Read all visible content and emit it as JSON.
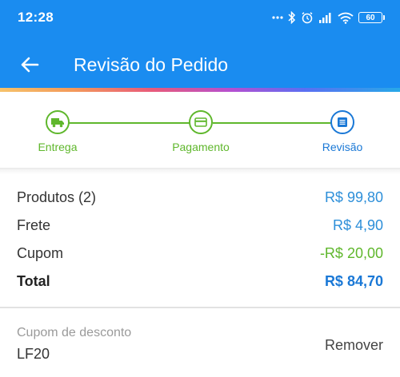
{
  "status_bar": {
    "time": "12:28",
    "battery": "60",
    "icons": [
      "more-dots-icon",
      "bluetooth-icon",
      "alarm-icon",
      "signal-icon",
      "wifi-icon",
      "battery-icon"
    ]
  },
  "app_bar": {
    "title": "Revisão do Pedido",
    "back_icon": "arrow-left-icon",
    "color": "#1a8cf0"
  },
  "stepper": {
    "steps": [
      {
        "label": "Entrega",
        "icon": "truck-icon",
        "state": "completed"
      },
      {
        "label": "Pagamento",
        "icon": "credit-card-icon",
        "state": "completed"
      },
      {
        "label": "Revisão",
        "icon": "list-icon",
        "state": "active"
      }
    ],
    "completed_color": "#5fb72c",
    "active_color": "#1a78d6"
  },
  "summary": {
    "rows": [
      {
        "label": "Produtos (2)",
        "value": "R$ 99,80"
      },
      {
        "label": "Frete",
        "value": "R$ 4,90"
      },
      {
        "label": "Cupom",
        "value": "-R$ 20,00"
      },
      {
        "label": "Total",
        "value": "R$ 84,70"
      }
    ]
  },
  "coupon": {
    "label": "Cupom de desconto",
    "code": "LF20",
    "remove_label": "Remover"
  }
}
